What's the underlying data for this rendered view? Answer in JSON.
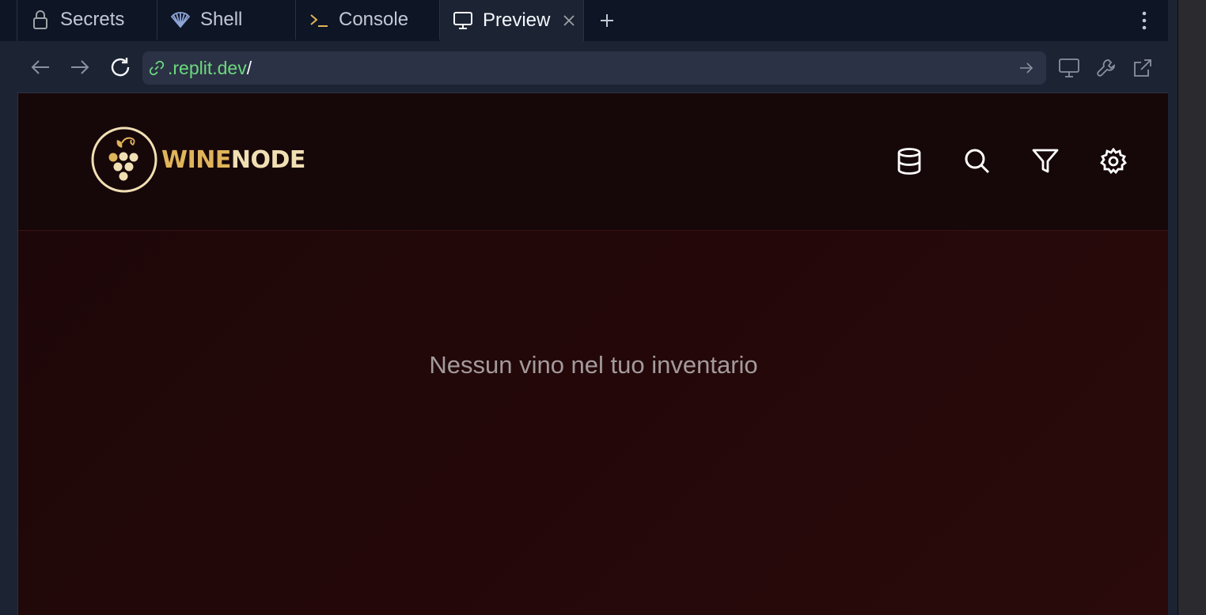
{
  "tabs": [
    {
      "label": "Secrets",
      "icon": "lock-icon"
    },
    {
      "label": "Shell",
      "icon": "shell-icon"
    },
    {
      "label": "Console",
      "icon": "terminal-icon"
    },
    {
      "label": "Preview",
      "icon": "monitor-icon",
      "active": true
    }
  ],
  "url": {
    "host": ".replit.dev",
    "path": "/"
  },
  "app": {
    "brand_part1": "WINE",
    "brand_part2": "NODE",
    "header_icons": [
      "database-icon",
      "search-icon",
      "filter-icon",
      "settings-icon"
    ],
    "empty_message": "Nessun vino nel tuo inventario"
  },
  "colors": {
    "url_host": "#6cd97e",
    "brand_gold": "#e0b45a",
    "brand_cream": "#f1dfb4",
    "background": "#230809"
  }
}
